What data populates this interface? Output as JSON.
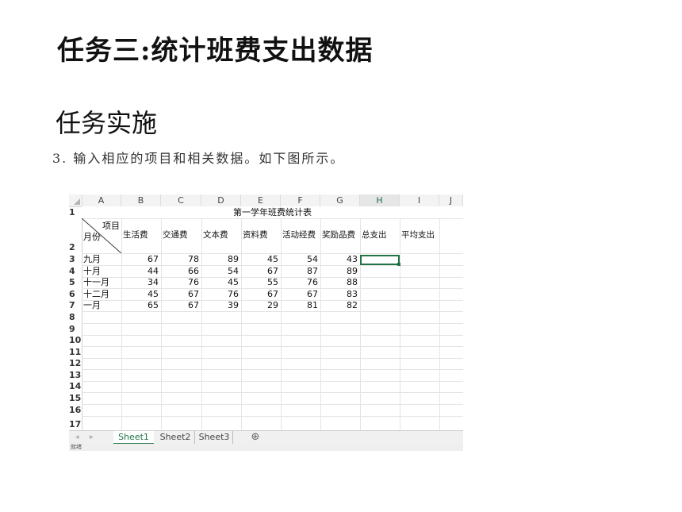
{
  "page": {
    "title": "任务三:统计班费支出数据",
    "subtitle": "任务实施",
    "step": "3. 输入相应的项目和相关数据。如下图所示。"
  },
  "spreadsheet": {
    "columns": [
      "A",
      "B",
      "C",
      "D",
      "E",
      "F",
      "G",
      "H",
      "I",
      "J"
    ],
    "selected_column": "H",
    "row_numbers": [
      "1",
      "2",
      "3",
      "4",
      "5",
      "6",
      "7",
      "8",
      "9",
      "10",
      "11",
      "12",
      "13",
      "14",
      "15",
      "16",
      "17"
    ],
    "sheet_title": "第一学年班费统计表",
    "diag_top": "项目",
    "diag_bottom": "月份",
    "headers": [
      "生活费",
      "交通费",
      "文本费",
      "资料费",
      "活动经费",
      "奖励品费",
      "总支出",
      "平均支出"
    ],
    "rows": [
      {
        "month": "九月",
        "values": [
          "67",
          "78",
          "89",
          "45",
          "54",
          "43"
        ]
      },
      {
        "month": "十月",
        "values": [
          "44",
          "66",
          "54",
          "67",
          "87",
          "89"
        ]
      },
      {
        "month": "十一月",
        "values": [
          "34",
          "76",
          "45",
          "55",
          "76",
          "88"
        ]
      },
      {
        "month": "十二月",
        "values": [
          "45",
          "67",
          "76",
          "67",
          "67",
          "83"
        ]
      },
      {
        "month": "一月",
        "values": [
          "65",
          "67",
          "39",
          "29",
          "81",
          "82"
        ]
      }
    ],
    "tabs": [
      "Sheet1",
      "Sheet2",
      "Sheet3"
    ],
    "active_tab": "Sheet1",
    "add_sheet_symbol": "⊕",
    "status_text": "就绪"
  }
}
